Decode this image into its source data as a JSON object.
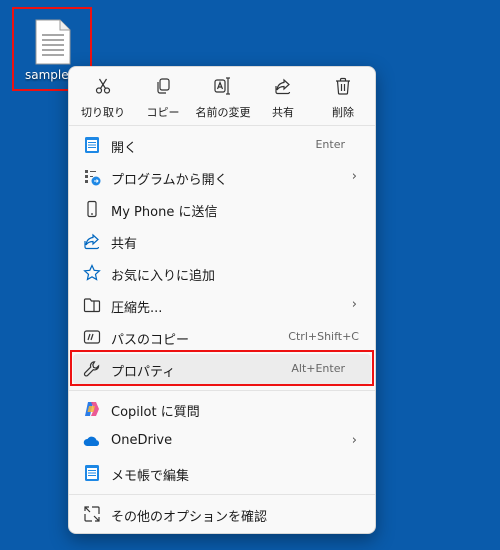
{
  "desktop": {
    "file_label": "sample.txt"
  },
  "toolbar": [
    {
      "label": "切り取り",
      "icon": "scissors-icon"
    },
    {
      "label": "コピー",
      "icon": "copy-icon"
    },
    {
      "label": "名前の変更",
      "icon": "rename-icon"
    },
    {
      "label": "共有",
      "icon": "share-icon"
    },
    {
      "label": "削除",
      "icon": "trash-icon"
    }
  ],
  "menu": [
    {
      "label": "開く",
      "shortcut": "Enter",
      "icon": "notepad-icon"
    },
    {
      "label": "プログラムから開く",
      "submenu": true,
      "icon": "open-with-icon"
    },
    {
      "label": "My Phone に送信",
      "icon": "phone-icon"
    },
    {
      "label": "共有",
      "icon": "share-icon"
    },
    {
      "label": "お気に入りに追加",
      "icon": "star-icon"
    },
    {
      "label": "圧縮先...",
      "submenu": true,
      "icon": "zip-folder-icon"
    },
    {
      "label": "パスのコピー",
      "shortcut": "Ctrl+Shift+C",
      "icon": "path-icon"
    },
    {
      "label": "プロパティ",
      "shortcut": "Alt+Enter",
      "icon": "wrench-icon"
    },
    {
      "label": "Copilot に質問",
      "icon": "copilot-icon"
    },
    {
      "label": "OneDrive",
      "submenu": true,
      "icon": "onedrive-icon"
    },
    {
      "label": "メモ帳で編集",
      "icon": "notepad-icon"
    },
    {
      "label": "その他のオプションを確認",
      "icon": "more-options-icon"
    }
  ],
  "colors": {
    "desktop": "#0a5bab",
    "highlight_box": "#e11111",
    "accent": "#0067c0"
  }
}
